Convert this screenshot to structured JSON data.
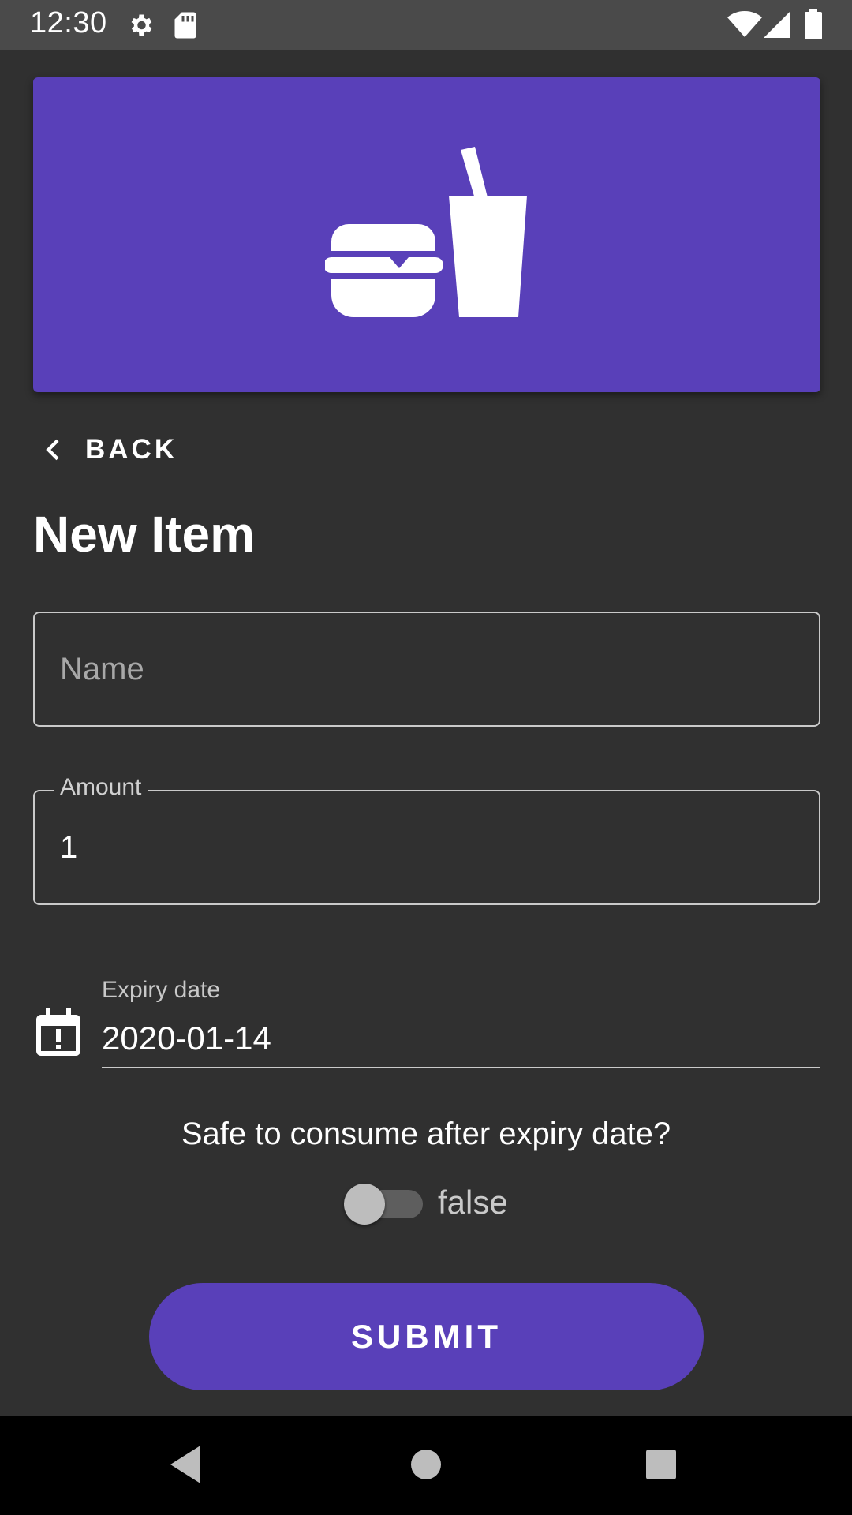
{
  "status_bar": {
    "time": "12:30",
    "icons": [
      "gear-icon",
      "sd-card-icon",
      "wifi-icon",
      "signal-icon",
      "battery-icon"
    ]
  },
  "hero": {
    "icon": "burger-drink-icon",
    "background_color": "#5940b9"
  },
  "navigation": {
    "back_label": "BACK"
  },
  "page": {
    "title": "New Item"
  },
  "form": {
    "name": {
      "placeholder": "Name",
      "value": ""
    },
    "amount": {
      "label": "Amount",
      "value": "1"
    },
    "expiry": {
      "label": "Expiry date",
      "value": "2020-01-14",
      "icon": "calendar-alert-icon"
    },
    "safe_after_expiry": {
      "question": "Safe to consume after expiry date?",
      "value": "false",
      "checked": false
    },
    "submit_label": "SUBMIT"
  },
  "nav_bar": {
    "icons": [
      "nav-back-icon",
      "nav-home-icon",
      "nav-recent-icon"
    ]
  },
  "colors": {
    "accent": "#5940b9",
    "background": "#303030",
    "status_bar": "#4a4a4a",
    "nav_bar": "#000000"
  }
}
